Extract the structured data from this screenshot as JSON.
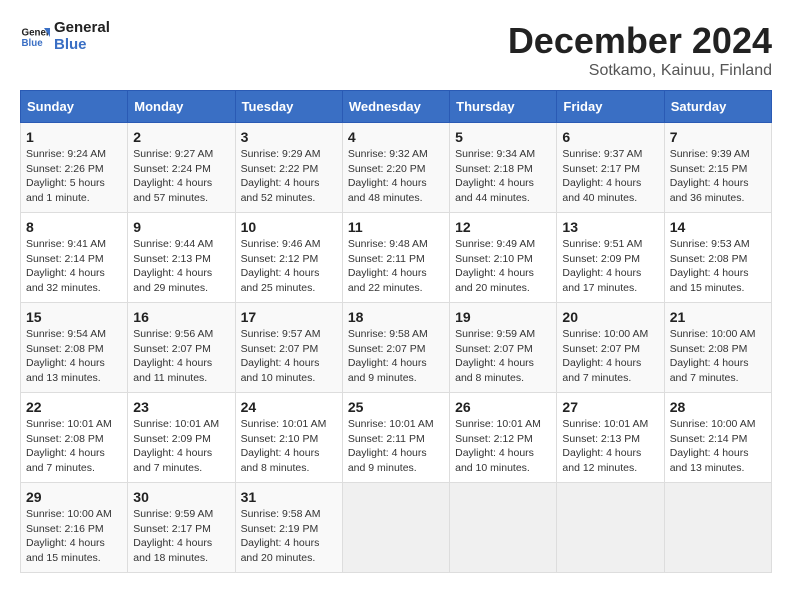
{
  "logo": {
    "line1": "General",
    "line2": "Blue"
  },
  "title": "December 2024",
  "subtitle": "Sotkamo, Kainuu, Finland",
  "days_of_week": [
    "Sunday",
    "Monday",
    "Tuesday",
    "Wednesday",
    "Thursday",
    "Friday",
    "Saturday"
  ],
  "weeks": [
    [
      {
        "day": "1",
        "info": "Sunrise: 9:24 AM\nSunset: 2:26 PM\nDaylight: 5 hours\nand 1 minute."
      },
      {
        "day": "2",
        "info": "Sunrise: 9:27 AM\nSunset: 2:24 PM\nDaylight: 4 hours\nand 57 minutes."
      },
      {
        "day": "3",
        "info": "Sunrise: 9:29 AM\nSunset: 2:22 PM\nDaylight: 4 hours\nand 52 minutes."
      },
      {
        "day": "4",
        "info": "Sunrise: 9:32 AM\nSunset: 2:20 PM\nDaylight: 4 hours\nand 48 minutes."
      },
      {
        "day": "5",
        "info": "Sunrise: 9:34 AM\nSunset: 2:18 PM\nDaylight: 4 hours\nand 44 minutes."
      },
      {
        "day": "6",
        "info": "Sunrise: 9:37 AM\nSunset: 2:17 PM\nDaylight: 4 hours\nand 40 minutes."
      },
      {
        "day": "7",
        "info": "Sunrise: 9:39 AM\nSunset: 2:15 PM\nDaylight: 4 hours\nand 36 minutes."
      }
    ],
    [
      {
        "day": "8",
        "info": "Sunrise: 9:41 AM\nSunset: 2:14 PM\nDaylight: 4 hours\nand 32 minutes."
      },
      {
        "day": "9",
        "info": "Sunrise: 9:44 AM\nSunset: 2:13 PM\nDaylight: 4 hours\nand 29 minutes."
      },
      {
        "day": "10",
        "info": "Sunrise: 9:46 AM\nSunset: 2:12 PM\nDaylight: 4 hours\nand 25 minutes."
      },
      {
        "day": "11",
        "info": "Sunrise: 9:48 AM\nSunset: 2:11 PM\nDaylight: 4 hours\nand 22 minutes."
      },
      {
        "day": "12",
        "info": "Sunrise: 9:49 AM\nSunset: 2:10 PM\nDaylight: 4 hours\nand 20 minutes."
      },
      {
        "day": "13",
        "info": "Sunrise: 9:51 AM\nSunset: 2:09 PM\nDaylight: 4 hours\nand 17 minutes."
      },
      {
        "day": "14",
        "info": "Sunrise: 9:53 AM\nSunset: 2:08 PM\nDaylight: 4 hours\nand 15 minutes."
      }
    ],
    [
      {
        "day": "15",
        "info": "Sunrise: 9:54 AM\nSunset: 2:08 PM\nDaylight: 4 hours\nand 13 minutes."
      },
      {
        "day": "16",
        "info": "Sunrise: 9:56 AM\nSunset: 2:07 PM\nDaylight: 4 hours\nand 11 minutes."
      },
      {
        "day": "17",
        "info": "Sunrise: 9:57 AM\nSunset: 2:07 PM\nDaylight: 4 hours\nand 10 minutes."
      },
      {
        "day": "18",
        "info": "Sunrise: 9:58 AM\nSunset: 2:07 PM\nDaylight: 4 hours\nand 9 minutes."
      },
      {
        "day": "19",
        "info": "Sunrise: 9:59 AM\nSunset: 2:07 PM\nDaylight: 4 hours\nand 8 minutes."
      },
      {
        "day": "20",
        "info": "Sunrise: 10:00 AM\nSunset: 2:07 PM\nDaylight: 4 hours\nand 7 minutes."
      },
      {
        "day": "21",
        "info": "Sunrise: 10:00 AM\nSunset: 2:08 PM\nDaylight: 4 hours\nand 7 minutes."
      }
    ],
    [
      {
        "day": "22",
        "info": "Sunrise: 10:01 AM\nSunset: 2:08 PM\nDaylight: 4 hours\nand 7 minutes."
      },
      {
        "day": "23",
        "info": "Sunrise: 10:01 AM\nSunset: 2:09 PM\nDaylight: 4 hours\nand 7 minutes."
      },
      {
        "day": "24",
        "info": "Sunrise: 10:01 AM\nSunset: 2:10 PM\nDaylight: 4 hours\nand 8 minutes."
      },
      {
        "day": "25",
        "info": "Sunrise: 10:01 AM\nSunset: 2:11 PM\nDaylight: 4 hours\nand 9 minutes."
      },
      {
        "day": "26",
        "info": "Sunrise: 10:01 AM\nSunset: 2:12 PM\nDaylight: 4 hours\nand 10 minutes."
      },
      {
        "day": "27",
        "info": "Sunrise: 10:01 AM\nSunset: 2:13 PM\nDaylight: 4 hours\nand 12 minutes."
      },
      {
        "day": "28",
        "info": "Sunrise: 10:00 AM\nSunset: 2:14 PM\nDaylight: 4 hours\nand 13 minutes."
      }
    ],
    [
      {
        "day": "29",
        "info": "Sunrise: 10:00 AM\nSunset: 2:16 PM\nDaylight: 4 hours\nand 15 minutes."
      },
      {
        "day": "30",
        "info": "Sunrise: 9:59 AM\nSunset: 2:17 PM\nDaylight: 4 hours\nand 18 minutes."
      },
      {
        "day": "31",
        "info": "Sunrise: 9:58 AM\nSunset: 2:19 PM\nDaylight: 4 hours\nand 20 minutes."
      },
      {
        "day": "",
        "info": ""
      },
      {
        "day": "",
        "info": ""
      },
      {
        "day": "",
        "info": ""
      },
      {
        "day": "",
        "info": ""
      }
    ]
  ]
}
